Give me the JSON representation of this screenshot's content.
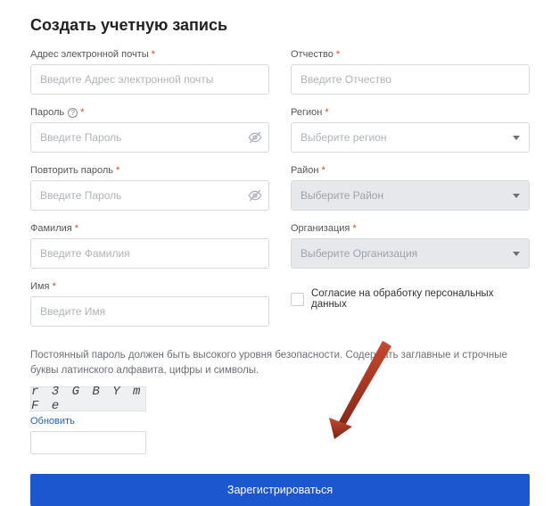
{
  "title": "Создать учетную запись",
  "left": {
    "email": {
      "label": "Адрес электронной почты",
      "placeholder": "Введите Адрес электронной почты"
    },
    "password": {
      "label": "Пароль",
      "placeholder": "Введите Пароль"
    },
    "password2": {
      "label": "Повторить пароль",
      "placeholder": "Введите Пароль"
    },
    "lastname": {
      "label": "Фамилия",
      "placeholder": "Введите Фамилия"
    },
    "firstname": {
      "label": "Имя",
      "placeholder": "Введите Имя"
    }
  },
  "right": {
    "patronymic": {
      "label": "Отчество",
      "placeholder": "Введите Отчество"
    },
    "region": {
      "label": "Регион",
      "placeholder": "Выберите регион"
    },
    "district": {
      "label": "Район",
      "placeholder": "Выберите Район"
    },
    "org": {
      "label": "Организация",
      "placeholder": "Выберите Организация"
    },
    "consent": {
      "label": "Согласие на обработку персональных данных"
    }
  },
  "hint": "Постоянный пароль должен быть высокого уровня безопасности. Содержать заглавные и строчные буквы латинского алфавита, цифры и символы.",
  "captcha": {
    "text": "r 3 G B Y m F e",
    "refresh": "Обновить"
  },
  "submit": "Зарегистрироваться",
  "asterisk": "*",
  "info_glyph": "?"
}
